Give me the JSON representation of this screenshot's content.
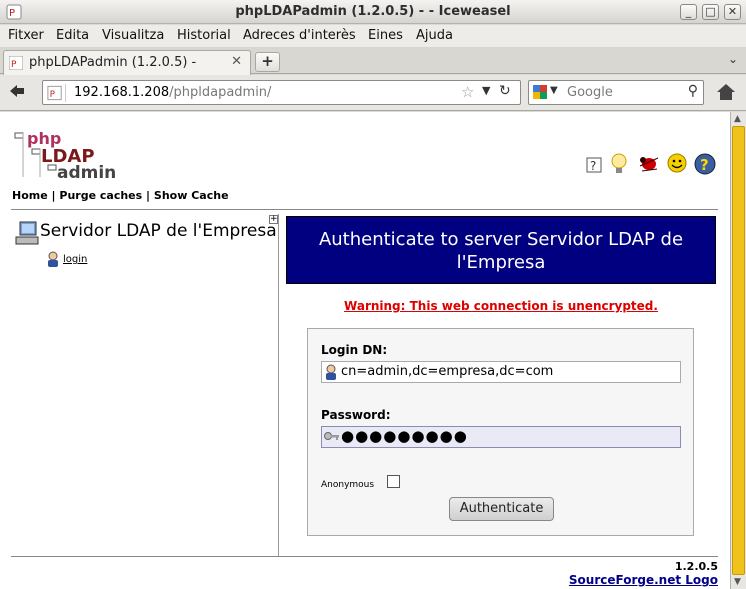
{
  "window": {
    "title": "phpLDAPadmin (1.2.0.5) - - Iceweasel",
    "buttons": [
      "_",
      "□",
      "✕"
    ]
  },
  "menubar": {
    "items": [
      "Fitxer",
      "Edita",
      "Visualitza",
      "Historial",
      "Adreces d'interès",
      "Eines",
      "Ajuda"
    ]
  },
  "tabs": [
    {
      "label": "phpLDAPadmin (1.2.0.5) -",
      "close": "✕"
    }
  ],
  "newtab_label": "+",
  "tablist_icon": "⌄",
  "navbar": {
    "back_icon": "back-arrow-icon",
    "url_host": "192.168.1.208",
    "url_path": "/phpldapadmin/",
    "search_placeholder": "Google"
  },
  "page": {
    "logo_text": [
      "php",
      "LDAP",
      "admin"
    ],
    "top_links": [
      "Home",
      "Purge caches",
      "Show Cache"
    ],
    "link_separator": "|",
    "server_name": "Servidor LDAP de l'Empresa",
    "login_link": "login",
    "auth_title": "Authenticate to server Servidor LDAP de l'Empresa",
    "warning": "Warning: This web connection is unencrypted.",
    "login_dn_label": "Login DN:",
    "login_dn_value": "cn=admin,dc=empresa,dc=com",
    "password_label": "Password:",
    "password_mask": "●●●●●●●●●",
    "anonymous_label": "Anonymous",
    "anonymous_checked": false,
    "auth_button": "Authenticate",
    "version": "1.2.0.5",
    "footer_link": "SourceForge.net Logo"
  },
  "colors": {
    "auth_header_bg": "#000080",
    "warning": "#dd0000",
    "scroll_thumb": "#f0c21c",
    "footer_link": "#00008b"
  }
}
